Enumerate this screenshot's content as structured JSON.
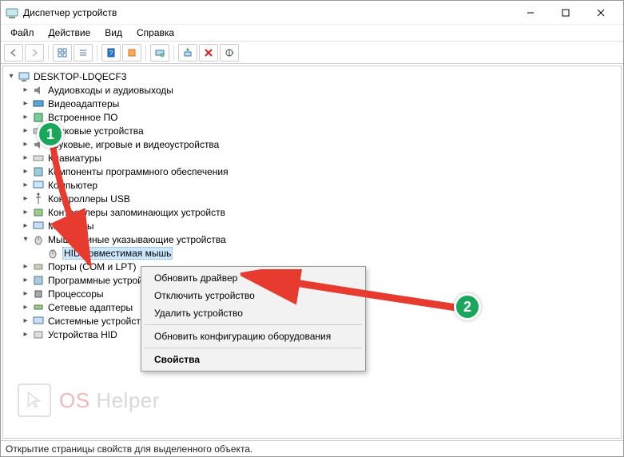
{
  "window": {
    "title": "Диспетчер устройств"
  },
  "menu": {
    "file": "Файл",
    "action": "Действие",
    "view": "Вид",
    "help": "Справка"
  },
  "tree": {
    "root": "DESKTOP-LDQECF3",
    "cat_audio": "Аудиовходы и аудиовыходы",
    "cat_video": "Видеоадаптеры",
    "cat_firmware": "Встроенное ПО",
    "cat_disk": "Дисковые устройства",
    "cat_sound": "Звуковые, игровые и видеоустройства",
    "cat_keyboard": "Клавиатуры",
    "cat_software": "Компоненты программного обеспечения",
    "cat_computer": "Компьютер",
    "cat_usb": "Контроллеры USB",
    "cat_storage": "Контроллеры запоминающих устройств",
    "cat_monitor": "Мониторы",
    "cat_mouse": "Мыши и иные указывающие устройства",
    "dev_hid_mouse": "HID-совместимая мышь",
    "cat_ports": "Порты (COM и LPT)",
    "cat_swdev": "Программные устройства",
    "cat_cpu": "Процессоры",
    "cat_net": "Сетевые адаптеры",
    "cat_system": "Системные устройства",
    "cat_hid": "Устройства HID"
  },
  "context_menu": {
    "update": "Обновить драйвер",
    "disable": "Отключить устройство",
    "uninstall": "Удалить устройство",
    "scan": "Обновить конфигурацию оборудования",
    "properties": "Свойства"
  },
  "annotations": {
    "b1": "1",
    "b2": "2"
  },
  "status": {
    "text": "Открытие страницы свойств для выделенного объекта."
  },
  "watermark": {
    "os": "OS",
    "helper": "Helper"
  }
}
